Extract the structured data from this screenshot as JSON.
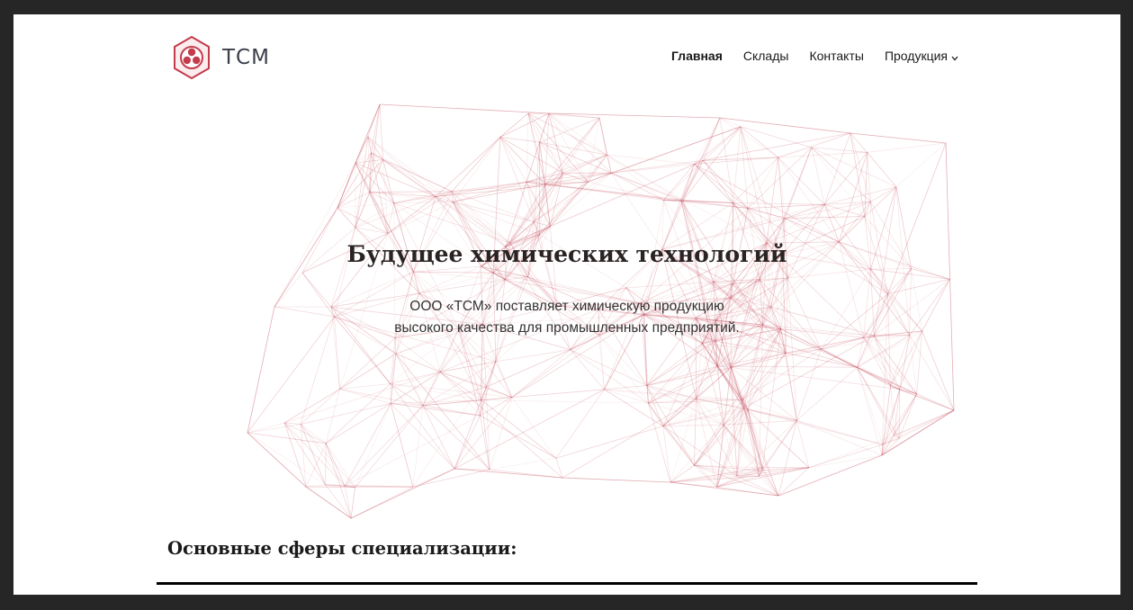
{
  "brand": {
    "name": "ТСМ",
    "logo_color": "#c43c4c"
  },
  "nav": {
    "items": [
      {
        "label": "Главная",
        "active": true
      },
      {
        "label": "Склады",
        "active": false
      },
      {
        "label": "Контакты",
        "active": false
      },
      {
        "label": "Продукция",
        "active": false,
        "has_dropdown": true
      }
    ]
  },
  "hero": {
    "title": "Будущее химических технологий",
    "subtitle_line1": "ООО «ТСМ» поставляет химическую продукцию",
    "subtitle_line2": "высокого качества для промышленных предприятий.",
    "network_color": "#c44a5a",
    "icon": "molecular-network-graphic"
  },
  "section": {
    "title": "Основные сферы специализации:"
  },
  "colors": {
    "frame": "#262626",
    "background": "#ffffff",
    "text": "#1a1a1a"
  }
}
